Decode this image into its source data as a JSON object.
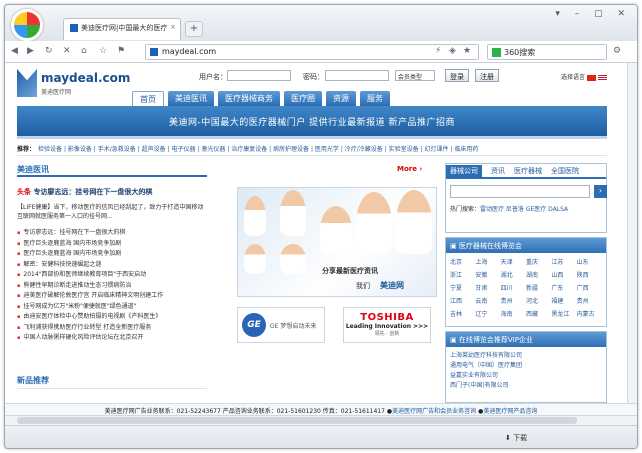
{
  "browser": {
    "tab_title": "美迪医疗网|中国最大的医疗",
    "url": "maydeal.com",
    "search_text": "360搜索",
    "new_tab": "+",
    "tab_close": "×",
    "status_download": "下载"
  },
  "header": {
    "brand": "maydeal.com",
    "brand_sub": "美迪医疗网",
    "user_label": "用户名：",
    "pass_label": "密码：",
    "member_type": "会员类型",
    "login": "登录",
    "register": "注册",
    "lang": "选择语言"
  },
  "nav": [
    "首页",
    "美迪医讯",
    "医疗器械商务",
    "医疗圈",
    "资源",
    "服务"
  ],
  "banner": "美迪网-中国最大的医疗器械门户 提供行业最新报道 新产品推广招商",
  "tags": {
    "label": "推荐：",
    "items": [
      "检验设备",
      "影像设备",
      "手术/急救设备",
      "超声设备",
      "电子仪器",
      "激光仪器",
      "治疗康复设备",
      "病房护理设备",
      "医用光学",
      "冷疗/冷藏设备",
      "实验室设备",
      "幻灯课件",
      "临床用药"
    ]
  },
  "news": {
    "section": "美迪医讯",
    "more": "More",
    "headline_prefix": "头条",
    "headline": "专访廖志远：挂号网在下一盘很大的棋",
    "intro": "【LIFE健康】当下，移动医疗的信风已经刮起了，致力于打造中国移动互联网就医服务第一入口的挂号网...",
    "items": [
      "专访廖志远：挂号网在下一盘很大的棋",
      "医疗巨头逐鹿蓝海 国内市场竞争加剧",
      "医疗巨头逐鹿蓝海 国内市场竞争加剧",
      "解密：安健科技快速崛起之谜",
      "2014\"西部协和医师继续教育项目\"于西安启动",
      "熊健性早期诊断走进推动生态习惯病防治",
      "迪美医疗破解伦敦医疗宫 开启临床精神文明创建工作",
      "挂号网成为亿万\"米粉\"便捷就医\"绿色通道\"",
      "由迪安医疗体检中心赞助拍摄的电视剧《产科医生》",
      "飞利浦获得携助医疗行业转型 打造全新医疗服务",
      "中国人动脉粥样硬化风险评估论坛在北京召开"
    ],
    "section2": "新品推荐"
  },
  "feature": {
    "caption": "分享最新医疗资讯",
    "caption2": "我们",
    "brand": "美迪网"
  },
  "ads": {
    "ge_logo": "GE",
    "ge_text": "GE 梦想启动未来",
    "toshiba": "TOSHIBA",
    "toshiba_tag": "Leading Innovation >>>",
    "toshiba_sub": "领先 · 创新"
  },
  "right": {
    "tabs": [
      "器械公司",
      "资讯",
      "医疗器械",
      "全国医院"
    ],
    "search_btn": "›",
    "hot_label": "热门搜索：",
    "hot": "雷动医疗 尼普洛 GE医疗 DALSA",
    "provinces_title": "医疗器械在线博览会",
    "provinces": [
      "北京",
      "上海",
      "天津",
      "重庆",
      "江苏",
      "山东",
      "浙江",
      "安徽",
      "湖北",
      "湖南",
      "山西",
      "陕西",
      "宁夏",
      "甘肃",
      "四川",
      "新疆",
      "广东",
      "广西",
      "江西",
      "云南",
      "贵州",
      "河北",
      "福建",
      "贵州",
      "吉林",
      "辽宁",
      "海南",
      "西藏",
      "黑龙江",
      "内蒙古"
    ],
    "vip_title": "在线博览会推荐VIP企业",
    "vip": [
      "上海莱幼医疗科技有限公司",
      "通用电气（中国）医疗集团",
      "益嘉实业有限公司",
      "西门子(中国)有限公司"
    ]
  },
  "footer": {
    "text": "美迪医疗网广告业务联系：021-52243677 产品咨询业务联系：021-51601230 传真：021-51611417",
    "link1": "美迪医疗网广告和会员业务咨询",
    "link2": "美迪医疗网产品咨询"
  }
}
